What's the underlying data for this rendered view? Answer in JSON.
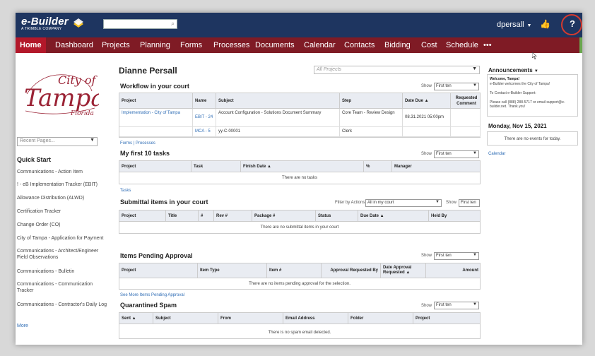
{
  "app": {
    "brand": "e-Builder",
    "brand_sub": "A TRIMBLE COMPANY",
    "search_placeholder": "",
    "user": "dpersall",
    "help": "?"
  },
  "nav": [
    "Home",
    "Dashboard",
    "Projects",
    "Planning",
    "Forms",
    "Processes",
    "Documents",
    "Calendar",
    "Contacts",
    "Bidding",
    "Cost",
    "Schedule",
    "•••"
  ],
  "sidebar": {
    "city_logo_city": "City of",
    "city_logo_name": "Tampa",
    "city_logo_state": "Florida",
    "recent_placeholder": "Recent Pages...",
    "quick_start_title": "Quick Start",
    "items": [
      "Communications - Action Item",
      "! - eB Implementation Tracker (EBIT)",
      "Allowance Distribution (ALWD)",
      "Certification Tracker",
      "Change Order (CO)",
      "City of Tampa - Application for Payment",
      "Communications - Architect/Engineer Field Observations",
      "Communications - Bulletin",
      "Communications - Communication Tracker",
      "Communications - Contractor's Daily Log"
    ],
    "more": "More"
  },
  "main": {
    "user_title": "Dianne Persall",
    "project_select": "All Projects",
    "show_label": "Show",
    "show_value": "First ten",
    "workflow": {
      "title": "Workflow in your court",
      "headers": [
        "Project",
        "Name",
        "Subject",
        "Step",
        "Date Due ▲",
        "Requested Comment"
      ],
      "rows": [
        [
          "Implementation - City of Tampa",
          "EBIT - 24",
          "Account Configuration - Solutions Document Summary",
          "Core Team - Review Design",
          "08.31.2021 05:00pm",
          ""
        ],
        [
          "",
          "MCA - 5",
          "yy-C-00001",
          "Clerk",
          "",
          ""
        ]
      ],
      "footer_link": "Forms | Processes"
    },
    "tasks": {
      "title": "My first 10 tasks",
      "headers": [
        "Project",
        "Task",
        "Finish Date ▲",
        "%",
        "Manager"
      ],
      "empty": "There are no tasks",
      "footer_link": "Tasks"
    },
    "submittals": {
      "title": "Submittal items in your court",
      "filter_label": "Filter by Actions",
      "filter_value": "All in my court",
      "headers": [
        "Project",
        "Title",
        "#",
        "Rev #",
        "Package #",
        "Status",
        "Due Date ▲",
        "Held By"
      ],
      "empty": "There are no submittal items in your court"
    },
    "pending": {
      "title": "Items Pending Approval",
      "headers": [
        "Project",
        "Item Type",
        "Item #",
        "Approval Requested By",
        "Date Approval Requested ▲",
        "Amount"
      ],
      "empty": "There are no items pending approval for the selection.",
      "footer_link": "See More Items Pending Approval"
    },
    "spam": {
      "title": "Quarantined Spam",
      "headers": [
        "Sent ▲",
        "Subject",
        "From",
        "Email Address",
        "Folder",
        "Project"
      ],
      "empty": "There is no spam email detected."
    }
  },
  "right": {
    "announcements_title": "Announcements",
    "welcome_title": "Welcome, Tampa!",
    "welcome_text": "e-Builder welcomes the City of Tampa!",
    "contact_text": "To Contact e-Builder Support:",
    "support_text": "Please call (888) 288-5717 or email support@e-builder.net. Thank you!",
    "date_title": "Monday, Nov 15, 2021",
    "events_text": "There are no events for today.",
    "calendar_link": "Calendar"
  },
  "colors": {
    "topbar": "#1e3560",
    "nav": "#7f1b25",
    "nav_active": "#b3182a",
    "link": "#2f6db5",
    "highlight_ring": "#d63a2e"
  }
}
